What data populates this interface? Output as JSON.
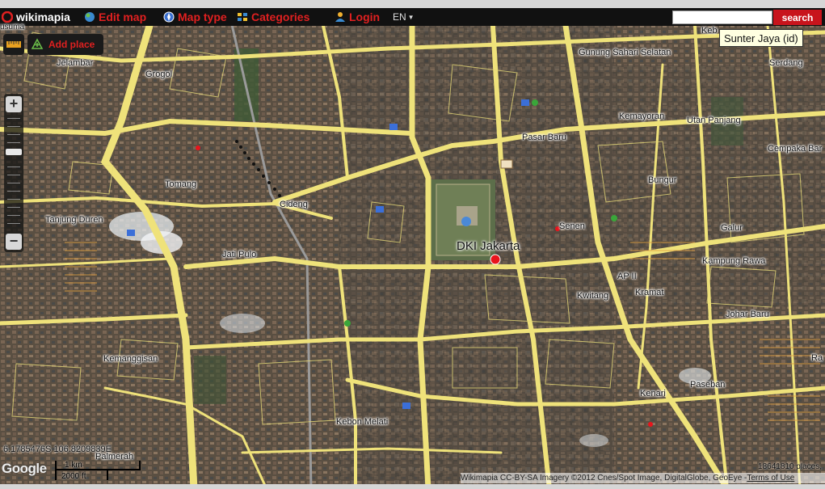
{
  "toolbar": {
    "logo": "wikimapia",
    "edit_map": "Edit map",
    "map_type": "Map type",
    "categories": "Categories",
    "login": "Login",
    "language": "EN",
    "search_label": "search",
    "search_value": ""
  },
  "add_place": "Add place",
  "zoom": {
    "level_fraction": 0.4
  },
  "labels": {
    "jelambar": "Jelambar",
    "grogol": "Grogol",
    "tomang": "Tomang",
    "tanjung_duren": "Tanjung Duren",
    "cideng": "Cideng",
    "jati_pulo": "Jati Pulo",
    "kemanggisan": "Kemanggisan",
    "palmerah": "Palmerah",
    "kebon_melati": "Kebon Melati",
    "dki_jakarta": "DKI Jakarta",
    "gunung_sahari": "Gunung Sahari Selatan",
    "pasar_baru": "Pasar Baru",
    "kemayoran": "Kemayoran",
    "utan_panjang": "Utan Panjang",
    "serdang": "Serdang",
    "cempaka_baru": "Cempaka Bar",
    "bungur": "Bungur",
    "senen": "Senen",
    "galur": "Galur",
    "kampung_rawa": "Kampung Rawa",
    "ap_ii": "AP II",
    "kramat": "Kramat",
    "kwitang": "Kwitang",
    "johar_baru": "Johar Baru",
    "paseban": "Paseban",
    "kenari": "Kenari",
    "ra": "Ra",
    "usuma": "usuma",
    "keb": "Keb"
  },
  "tooltip": "Sunter Jaya (id)",
  "coordinates": "6.1785476S 106.8209839E",
  "scale": {
    "km": "1 km",
    "ft": "2000 ft"
  },
  "brand": "Google",
  "places_count": "18641810 places,",
  "attribution": "Wikimapia CC-BY-SA  Imagery ©2012 Cnes/Spot Image, DigitalGlobe, GeoEye - ",
  "terms": "Terms of Use",
  "colors": {
    "road": "#efe27a",
    "marker": "#e8141c",
    "toolbar_red": "#e02020",
    "search_button": "#c8141c"
  }
}
